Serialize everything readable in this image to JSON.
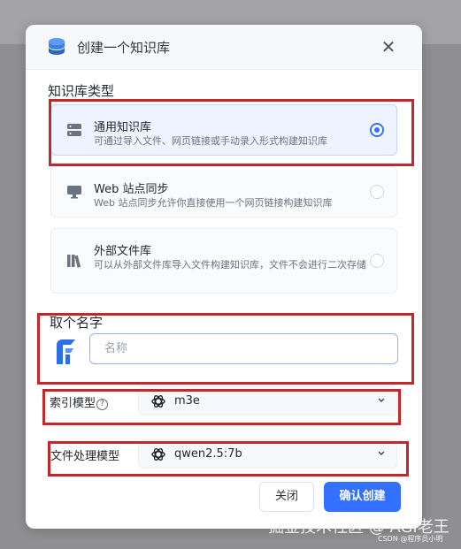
{
  "dialog": {
    "title": "创建一个知识库",
    "icons": {
      "header": "database-icon",
      "close": "close-icon"
    }
  },
  "kb_type": {
    "label": "知识库类型",
    "options": [
      {
        "title": "通用知识库",
        "desc": "可通过导入文件、网页链接或手动录入形式构建知识库",
        "icon": "server-icon",
        "selected": true
      },
      {
        "title": "Web 站点同步",
        "desc": "Web 站点同步允许你直接使用一个网页链接构建知识库",
        "icon": "monitor-icon",
        "selected": false
      },
      {
        "title": "外部文件库",
        "desc": "可以从外部文件库导入文件构建知识库，文件不会进行二次存储",
        "icon": "books-icon",
        "selected": false
      }
    ]
  },
  "name_section": {
    "label": "取个名字",
    "placeholder": "名称",
    "value": ""
  },
  "index_model": {
    "label": "索引模型",
    "value": "m3e",
    "icon": "openai-icon"
  },
  "file_model": {
    "label": "文件处理模型",
    "value": "qwen2.5:7b",
    "icon": "openai-icon"
  },
  "buttons": {
    "cancel": "关闭",
    "confirm": "确认创建"
  },
  "colors": {
    "accent": "#3370ff",
    "highlight_box": "#c3272b"
  },
  "watermark": {
    "main": "掘金技术社区 @ AGI老王",
    "sub": "CSDN @程序员小明"
  }
}
